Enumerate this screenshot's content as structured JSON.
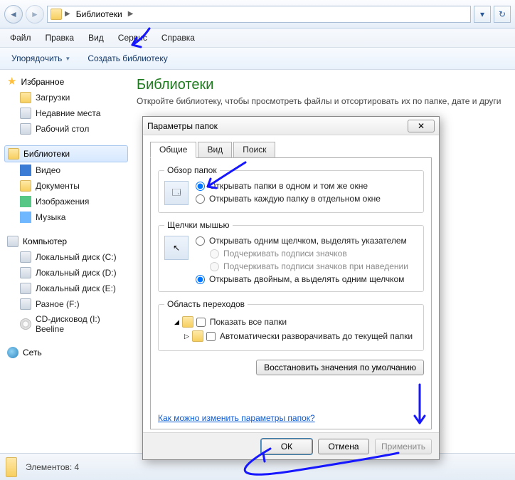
{
  "addressbar": {
    "root": "Библиотеки",
    "sep": "▶"
  },
  "menubar": [
    "Файл",
    "Правка",
    "Вид",
    "Сервис",
    "Справка"
  ],
  "toolbar": {
    "organize": "Упорядочить",
    "newlib": "Создать библиотеку"
  },
  "sidebar": {
    "favorites": {
      "title": "Избранное",
      "items": [
        "Загрузки",
        "Недавние места",
        "Рабочий стол"
      ]
    },
    "libraries": {
      "title": "Библиотеки",
      "items": [
        "Видео",
        "Документы",
        "Изображения",
        "Музыка"
      ]
    },
    "computer": {
      "title": "Компьютер",
      "items": [
        "Локальный диск (C:)",
        "Локальный диск (D:)",
        "Локальный диск (E:)",
        "Разное (F:)",
        "CD-дисковод (I:) Beeline"
      ]
    },
    "network": {
      "title": "Сеть"
    }
  },
  "content": {
    "title": "Библиотеки",
    "subtitle": "Откройте библиотеку, чтобы просмотреть файлы и отсортировать их по папке, дате и други"
  },
  "statusbar": {
    "label": "Элементов: 4"
  },
  "dialog": {
    "title": "Параметры папок",
    "tabs": [
      "Общие",
      "Вид",
      "Поиск"
    ],
    "browse": {
      "legend": "Обзор папок",
      "opt_same": "Открывать папки в одном и том же окне",
      "opt_new": "Открывать каждую папку в отдельном окне"
    },
    "click": {
      "legend": "Щелчки мышью",
      "single": "Открывать одним щелчком, выделять указателем",
      "underline_always": "Подчеркивать подписи значков",
      "underline_hover": "Подчеркивать подписи значков при наведении",
      "double": "Открывать двойным, а выделять одним щелчком"
    },
    "navpane": {
      "legend": "Область переходов",
      "show_all": "Показать все папки",
      "auto_expand": "Автоматически разворачивать до текущей папки"
    },
    "restore": "Восстановить значения по умолчанию",
    "help": "Как можно изменить параметры папок?",
    "buttons": {
      "ok": "ОК",
      "cancel": "Отмена",
      "apply": "Применить"
    }
  }
}
